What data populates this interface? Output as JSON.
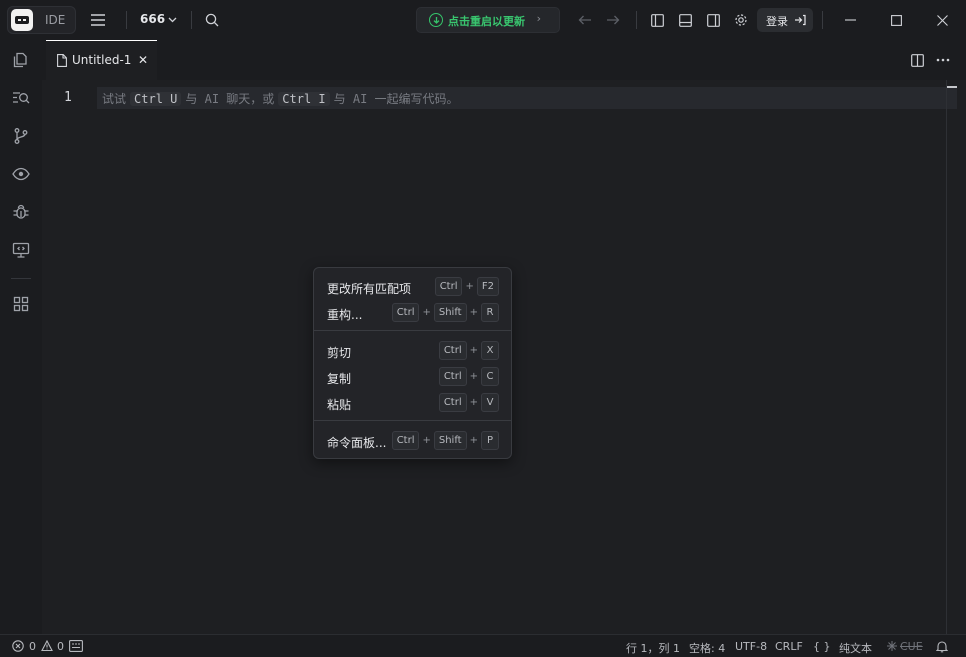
{
  "app": {
    "brand_label": "IDE",
    "project_name": "666"
  },
  "titlebar": {
    "update_label": "点击重启以更新",
    "update_chevron": "›",
    "login_label": "登录",
    "colors": {
      "update_green": "#39c66f"
    }
  },
  "icons": {
    "menu": "hamburger-menu-icon",
    "search": "search-icon",
    "back": "arrow-left-icon",
    "forward": "arrow-right-icon",
    "settings": "gear-icon"
  },
  "tabs": [
    {
      "label": "Untitled-1",
      "close": "✕",
      "active": true
    }
  ],
  "editor": {
    "line_number": "1",
    "hint": {
      "p1": "试试",
      "k1": "Ctrl U",
      "p2": "与 AI 聊天，或",
      "k2": "Ctrl I",
      "p3": "与 AI 一起编写代码。"
    }
  },
  "context_menu": {
    "items": [
      {
        "label": "更改所有匹配项",
        "keys": [
          "Ctrl",
          "F2"
        ]
      },
      {
        "label": "重构...",
        "keys": [
          "Ctrl",
          "Shift",
          "R"
        ]
      },
      {
        "label": "剪切",
        "keys": [
          "Ctrl",
          "X"
        ]
      },
      {
        "label": "复制",
        "keys": [
          "Ctrl",
          "C"
        ]
      },
      {
        "label": "粘贴",
        "keys": [
          "Ctrl",
          "V"
        ]
      },
      {
        "label": "命令面板...",
        "keys": [
          "Ctrl",
          "Shift",
          "P"
        ]
      }
    ],
    "plus": "+"
  },
  "statusbar": {
    "errors": "0",
    "warnings": "0",
    "position": "行 1，列 1",
    "spaces": "空格: 4",
    "encoding": "UTF-8",
    "eol": "CRLF",
    "braces": "{ }",
    "language": "纯文本",
    "cue": "CUE"
  }
}
